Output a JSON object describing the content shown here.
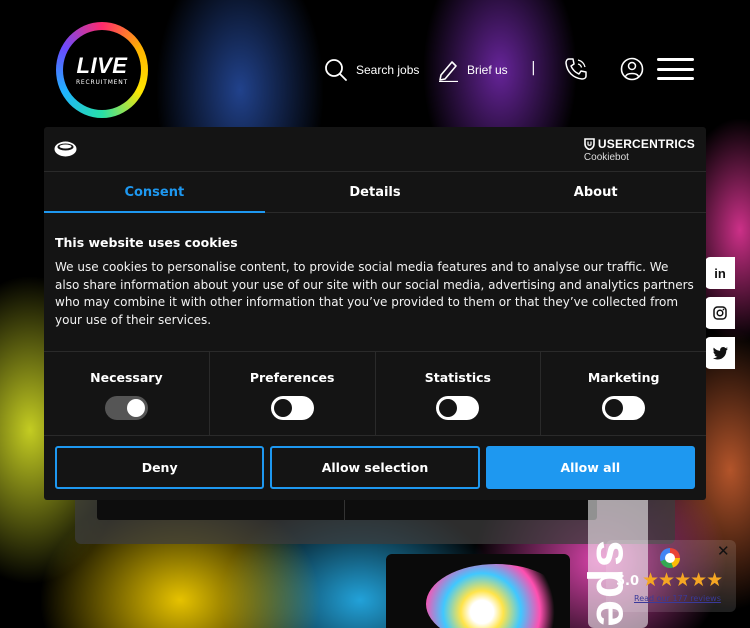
{
  "header": {
    "logo_word": "LIVE",
    "logo_sub": "RECRUITMENT",
    "nav": {
      "search_label": "Search jobs",
      "brief_label": "Brief us",
      "separator": "|"
    }
  },
  "cookie_dialog": {
    "brand_top": "USERCENTRICS",
    "brand_bottom": "Cookiebot",
    "tabs": [
      {
        "label": "Consent",
        "active": true
      },
      {
        "label": "Details",
        "active": false
      },
      {
        "label": "About",
        "active": false
      }
    ],
    "title": "This website uses cookies",
    "body": "We use cookies to personalise content, to provide social media features and to analyse our traffic. We also share information about your use of our site with our social media, advertising and analytics partners who may combine it with other information that you’ve provided to them or that they’ve collected from your use of their services.",
    "toggles": [
      {
        "label": "Necessary",
        "on": true,
        "disabled": true
      },
      {
        "label": "Preferences",
        "on": false,
        "disabled": false
      },
      {
        "label": "Statistics",
        "on": false,
        "disabled": false
      },
      {
        "label": "Marketing",
        "on": false,
        "disabled": false
      }
    ],
    "buttons": {
      "deny": "Deny",
      "allow_selection": "Allow selection",
      "allow_all": "Allow all"
    },
    "accent_color": "#1e98f0"
  },
  "social": [
    "linkedin-icon",
    "instagram-icon",
    "twitter-icon"
  ],
  "social_labels": {
    "linkedin": "in"
  },
  "background_word": "spec",
  "reviews": {
    "close": "✕",
    "score": "5.0",
    "stars": "★★★★★",
    "link": "Read our 177 reviews"
  }
}
